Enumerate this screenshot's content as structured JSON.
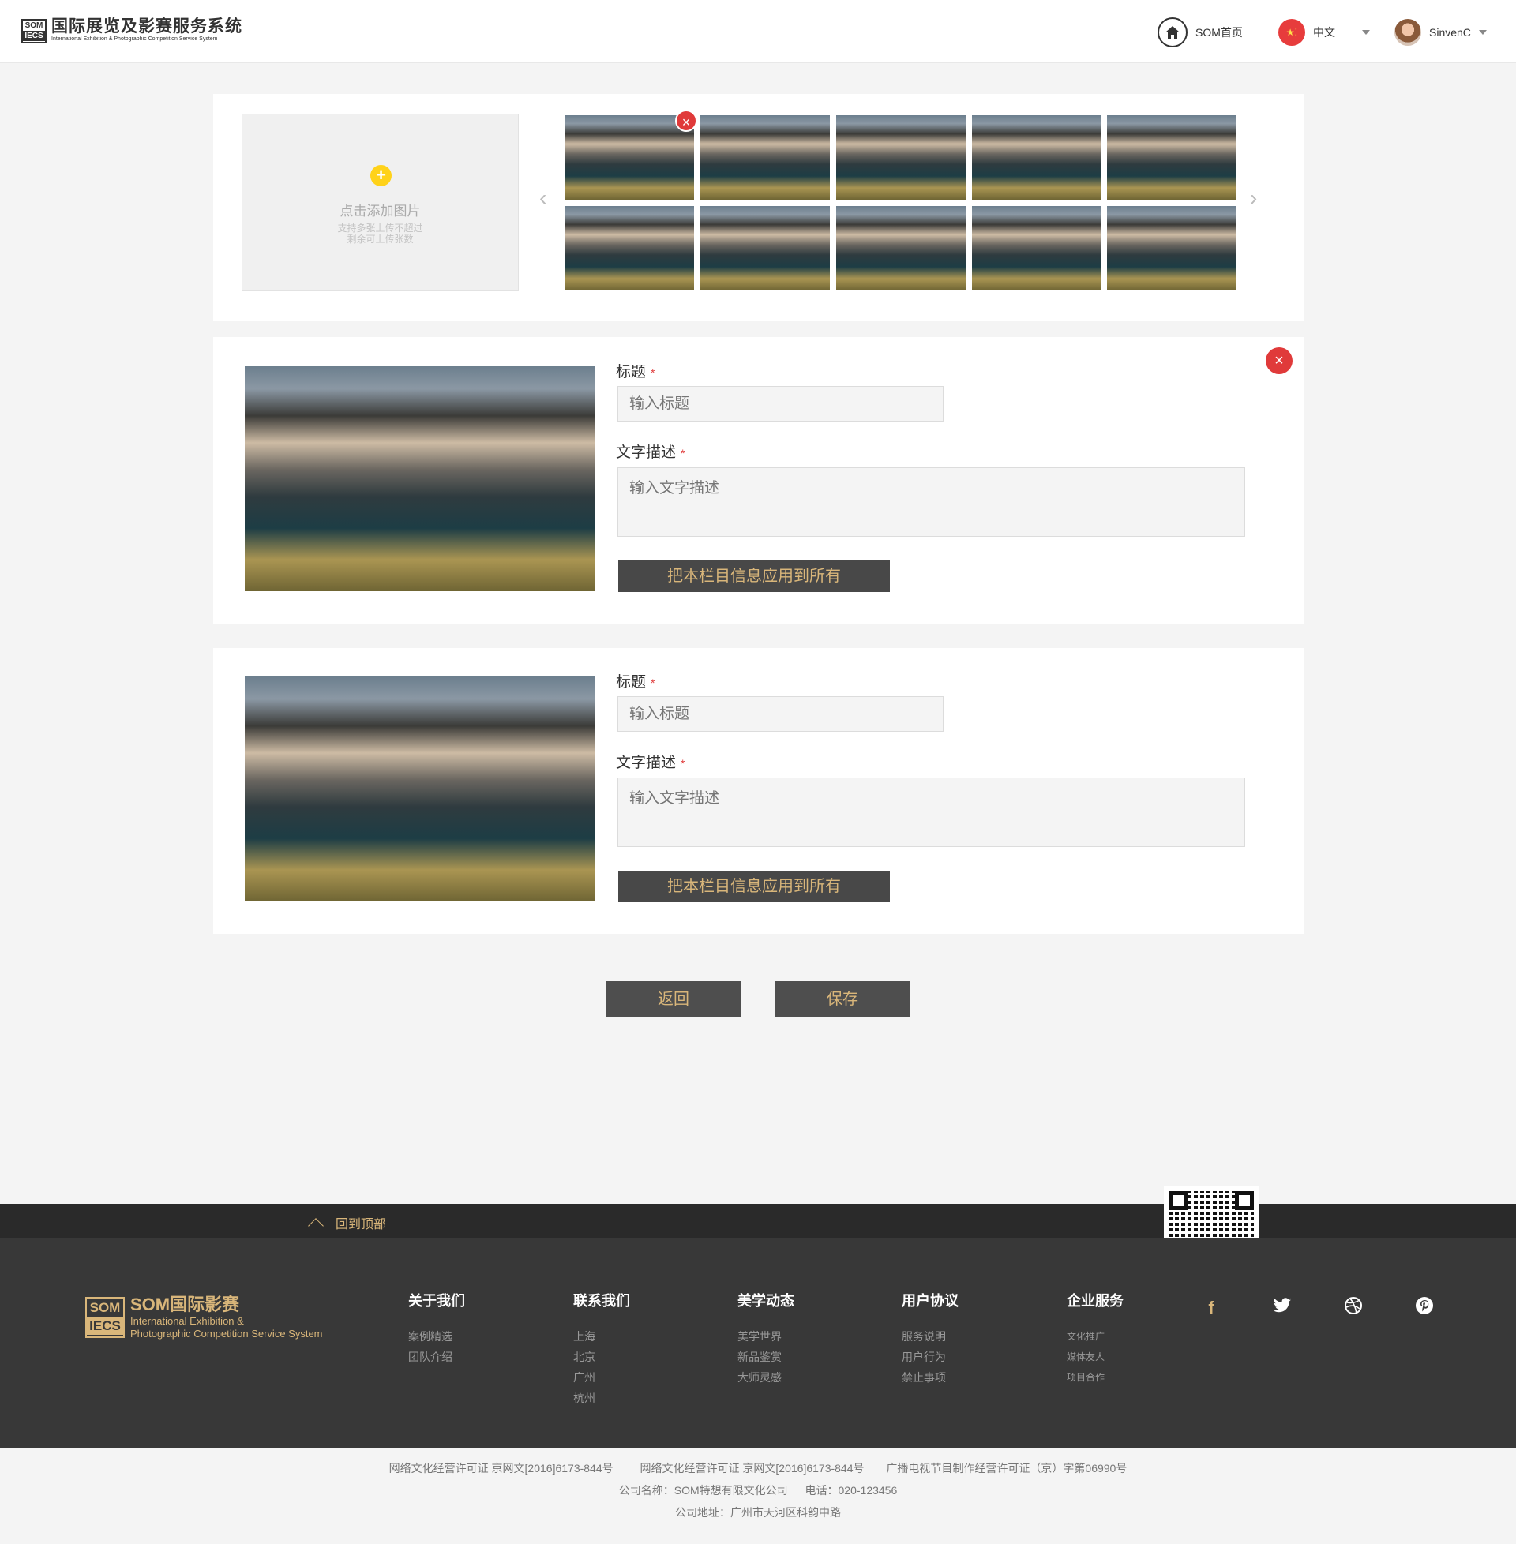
{
  "header": {
    "logo_badge_top": "SOM",
    "logo_badge_bottom": "IECS",
    "logo_cn": "国际展览及影赛服务系统",
    "logo_en": "International Exhibition & Photographic Competition Service System",
    "home_label": "SOM首页",
    "language_label": "中文",
    "user_name": "SinvenC"
  },
  "upload": {
    "add_label": "点击添加图片",
    "hint_line1": "支持多张上传不超过",
    "hint_line2": "剩余可上传张数",
    "thumbnail_count": 10
  },
  "entries": [
    {
      "title_label": "标题",
      "title_placeholder": "输入标题",
      "desc_label": "文字描述",
      "desc_placeholder": "输入文字描述",
      "apply_button": "把本栏目信息应用到所有"
    },
    {
      "title_label": "标题",
      "title_placeholder": "输入标题",
      "desc_label": "文字描述",
      "desc_placeholder": "输入文字描述",
      "apply_button": "把本栏目信息应用到所有"
    }
  ],
  "required_mark": "*",
  "actions": {
    "back": "返回",
    "save": "保存"
  },
  "footer": {
    "back_to_top": "回到顶部",
    "logo_badge_top": "SOM",
    "logo_badge_bottom": "IECS",
    "logo_cn": "SOM国际影赛",
    "logo_en_line1": "International Exhibition &",
    "logo_en_line2": "Photographic Competition Service System",
    "columns": [
      {
        "title": "关于我们",
        "links": [
          "案例精选",
          "团队介绍"
        ]
      },
      {
        "title": "联系我们",
        "links": [
          "上海",
          "北京",
          "广州",
          "杭州"
        ]
      },
      {
        "title": "美学动态",
        "links": [
          "美学世界",
          "新品鉴赏",
          "大师灵感"
        ]
      },
      {
        "title": "用户协议",
        "links": [
          "服务说明",
          "用户行为",
          "禁止事项"
        ]
      },
      {
        "title": "企业服务",
        "links": [
          "文化推广",
          "媒体友人",
          "项目合作"
        ]
      }
    ],
    "social_icons": [
      "facebook-icon",
      "twitter-icon",
      "dribbble-icon",
      "pinterest-icon"
    ]
  },
  "copyright": {
    "license1": "网络文化经营许可证 京网文[2016]6173-844号",
    "license2": "网络文化经营许可证 京网文[2016]6173-844号",
    "license3": "广播电视节目制作经营许可证（京）字第06990号",
    "company": "公司名称：SOM特想有限文化公司",
    "phone": "电话：020-123456",
    "address": "公司地址：广州市天河区科韵中路"
  },
  "colors": {
    "accent_gold": "#d9b67a",
    "remove_red": "#e03a3a",
    "add_yellow": "#ffd21a",
    "dark_button": "#484848"
  }
}
